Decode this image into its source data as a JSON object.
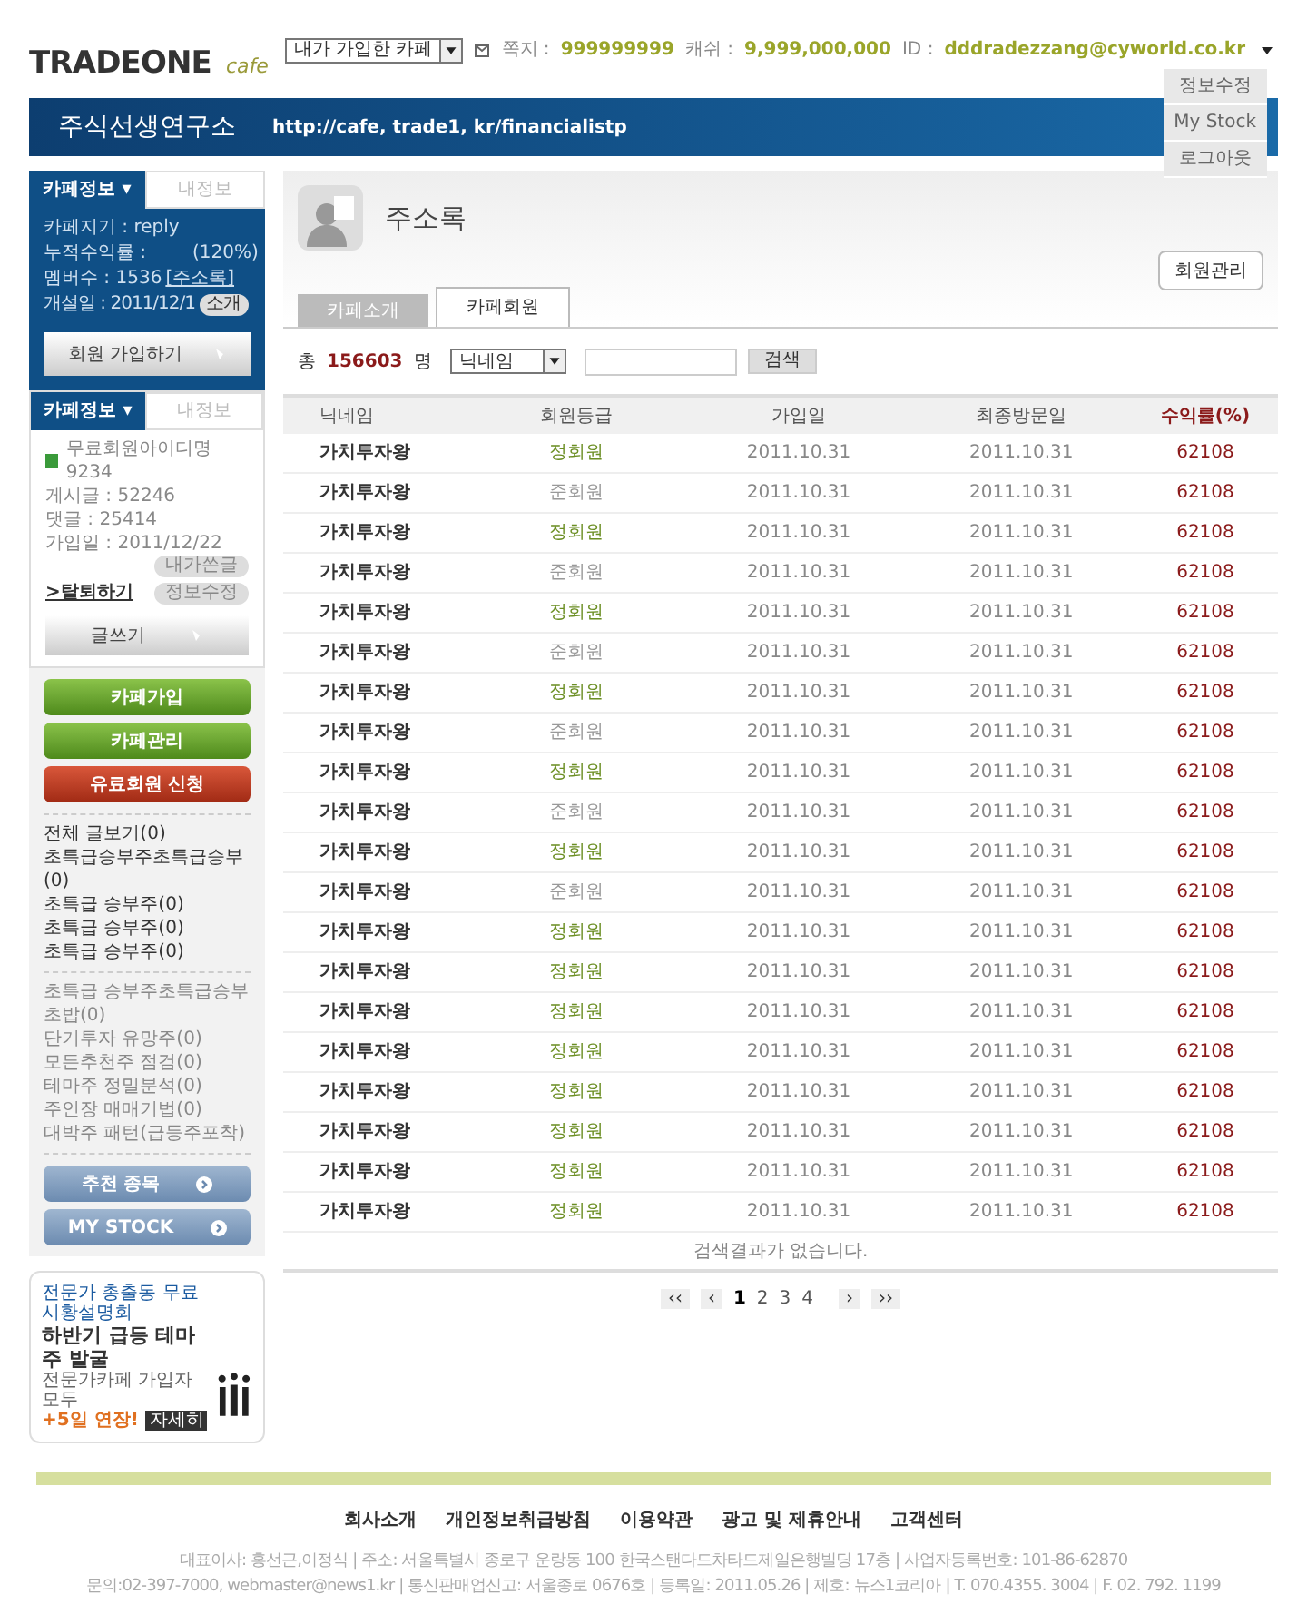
{
  "logo": {
    "brand": "TRADEONE",
    "sub": "cafe"
  },
  "topbar": {
    "cafe_select": "내가 가입한 카페",
    "note_label": "쪽지 :",
    "note_value": "999999999",
    "cash_label": "캐쉬 :",
    "cash_value": "9,999,000,000",
    "id_label": "ID :",
    "id_value": "dddradezzang@cyworld.co.kr"
  },
  "user_menu": {
    "expanded": true,
    "items": [
      "정보수정",
      "My Stock",
      "로그아웃"
    ]
  },
  "banner": {
    "title": "주식선생연구소",
    "url": "http://cafe, trade1, kr/financialistp"
  },
  "cafe_info": {
    "tabs": [
      {
        "label": "카페정보 ▾",
        "selected": true
      },
      {
        "label": "내정보",
        "selected": false
      }
    ],
    "lines": [
      "카페지기 : reply",
      "누적수익률 :        (120%)",
      "멤버수 : 1536"
    ],
    "roster_link": "[주소록]",
    "open_date": "개설일 : 2011/12/1",
    "intro_button": "소개",
    "join_button": "회원 가입하기"
  },
  "my_info": {
    "tabs": [
      {
        "label": "카페정보 ▾",
        "selected": true
      },
      {
        "label": "내정보",
        "selected": false
      }
    ],
    "member": "무료회원아이디명 9234",
    "posts": "게시글 : 52246",
    "comments": "댓글 : 25414",
    "joined": "가입일 : 2011/12/22",
    "my_posts_button": "내가쓴글",
    "leave_link": ">탈퇴하기",
    "edit_button": "정보수정",
    "write_button": "글쓰기"
  },
  "side_buttons": [
    {
      "label": "카페가입",
      "kind": "green"
    },
    {
      "label": "카페관리",
      "kind": "green"
    },
    {
      "label": "유료회원 신청",
      "kind": "red"
    }
  ],
  "board_menu": [
    "전체 글보기(0)",
    "초특급승부주초특급승부(0)",
    "초특급 승부주(0)",
    "초특급 승부주(0)",
    "초특급 승부주(0)"
  ],
  "board_menu_2": [
    "초특급 승부주초특급승부초밥(0)",
    "단기투자 유망주(0)",
    "모든추천주 점검(0)",
    "테마주 정밀분석(0)",
    "주인장 매매기법(0)",
    "대박주 패턴(급등주포착)"
  ],
  "stock_buttons": [
    "추천 종목",
    "MY STOCK"
  ],
  "ad": {
    "headline": "전문가 총출동 무료 시황설명회",
    "title": "하반기 급등 테마주 발굴",
    "note": "전문가카페 가입자 모두",
    "bonus": "+5일 연장!",
    "tag": "자세히"
  },
  "page": {
    "title": "주소록",
    "manage_button": "회원관리",
    "tabs": [
      {
        "label": "카페소개",
        "selected": false
      },
      {
        "label": "카페회원",
        "selected": true
      }
    ]
  },
  "search": {
    "total_label": "총",
    "total": "156603",
    "unit": "명",
    "field_select": "닉네임",
    "button": "검색"
  },
  "table": {
    "columns": [
      "닉네임",
      "회원등급",
      "가입일",
      "최종방문일",
      "수익률(%)"
    ],
    "rows": [
      {
        "nickname": "가치투자왕",
        "grade": "정회원",
        "color": "#6b8e23",
        "joined": "2011.10.31",
        "last_visit": "2011.10.31",
        "return": "62108"
      },
      {
        "nickname": "가치투자왕",
        "grade": "준회원",
        "color": "#999999",
        "joined": "2011.10.31",
        "last_visit": "2011.10.31",
        "return": "62108"
      },
      {
        "nickname": "가치투자왕",
        "grade": "정회원",
        "color": "#6b8e23",
        "joined": "2011.10.31",
        "last_visit": "2011.10.31",
        "return": "62108"
      },
      {
        "nickname": "가치투자왕",
        "grade": "준회원",
        "color": "#999999",
        "joined": "2011.10.31",
        "last_visit": "2011.10.31",
        "return": "62108"
      },
      {
        "nickname": "가치투자왕",
        "grade": "정회원",
        "color": "#6b8e23",
        "joined": "2011.10.31",
        "last_visit": "2011.10.31",
        "return": "62108"
      },
      {
        "nickname": "가치투자왕",
        "grade": "준회원",
        "color": "#999999",
        "joined": "2011.10.31",
        "last_visit": "2011.10.31",
        "return": "62108"
      },
      {
        "nickname": "가치투자왕",
        "grade": "정회원",
        "color": "#6b8e23",
        "joined": "2011.10.31",
        "last_visit": "2011.10.31",
        "return": "62108"
      },
      {
        "nickname": "가치투자왕",
        "grade": "준회원",
        "color": "#999999",
        "joined": "2011.10.31",
        "last_visit": "2011.10.31",
        "return": "62108"
      },
      {
        "nickname": "가치투자왕",
        "grade": "정회원",
        "color": "#6b8e23",
        "joined": "2011.10.31",
        "last_visit": "2011.10.31",
        "return": "62108"
      },
      {
        "nickname": "가치투자왕",
        "grade": "준회원",
        "color": "#999999",
        "joined": "2011.10.31",
        "last_visit": "2011.10.31",
        "return": "62108"
      },
      {
        "nickname": "가치투자왕",
        "grade": "정회원",
        "color": "#6b8e23",
        "joined": "2011.10.31",
        "last_visit": "2011.10.31",
        "return": "62108"
      },
      {
        "nickname": "가치투자왕",
        "grade": "준회원",
        "color": "#999999",
        "joined": "2011.10.31",
        "last_visit": "2011.10.31",
        "return": "62108"
      },
      {
        "nickname": "가치투자왕",
        "grade": "정회원",
        "color": "#6b8e23",
        "joined": "2011.10.31",
        "last_visit": "2011.10.31",
        "return": "62108"
      },
      {
        "nickname": "가치투자왕",
        "grade": "정회원",
        "color": "#6b8e23",
        "joined": "2011.10.31",
        "last_visit": "2011.10.31",
        "return": "62108"
      },
      {
        "nickname": "가치투자왕",
        "grade": "정회원",
        "color": "#6b8e23",
        "joined": "2011.10.31",
        "last_visit": "2011.10.31",
        "return": "62108"
      },
      {
        "nickname": "가치투자왕",
        "grade": "정회원",
        "color": "#6b8e23",
        "joined": "2011.10.31",
        "last_visit": "2011.10.31",
        "return": "62108"
      },
      {
        "nickname": "가치투자왕",
        "grade": "정회원",
        "color": "#6b8e23",
        "joined": "2011.10.31",
        "last_visit": "2011.10.31",
        "return": "62108"
      },
      {
        "nickname": "가치투자왕",
        "grade": "정회원",
        "color": "#6b8e23",
        "joined": "2011.10.31",
        "last_visit": "2011.10.31",
        "return": "62108"
      },
      {
        "nickname": "가치투자왕",
        "grade": "정회원",
        "color": "#6b8e23",
        "joined": "2011.10.31",
        "last_visit": "2011.10.31",
        "return": "62108"
      },
      {
        "nickname": "가치투자왕",
        "grade": "정회원",
        "color": "#6b8e23",
        "joined": "2011.10.31",
        "last_visit": "2011.10.31",
        "return": "62108"
      }
    ],
    "empty_message": "검색결과가 없습니다."
  },
  "pagination": {
    "first": "‹‹",
    "prev": "‹",
    "pages": [
      {
        "label": "1",
        "selected": true
      },
      {
        "label": "2",
        "selected": false
      },
      {
        "label": "3",
        "selected": false
      },
      {
        "label": "4",
        "selected": false
      }
    ],
    "next": "›",
    "last": "››"
  },
  "footer": {
    "links": [
      "회사소개",
      "개인정보취급방침",
      "이용약관",
      "광고 및 제휴안내",
      "고객센터"
    ],
    "lines": [
      "대표이사: 홍선근,이정식 | 주소: 서울특별시 종로구 운랑동 100 한국스탠다드차타드제일은행빌딩 17층 | 사업자등록번호: 101-86-62870",
      "문의:02-397-7000, webmaster@news1.kr | 통신판매업신고: 서울종로 0676호 | 등록일: 2011.05.26 | 제호: 뉴스1코리아 | T. 070.4355. 3004 | F. 02. 792. 1199"
    ]
  }
}
